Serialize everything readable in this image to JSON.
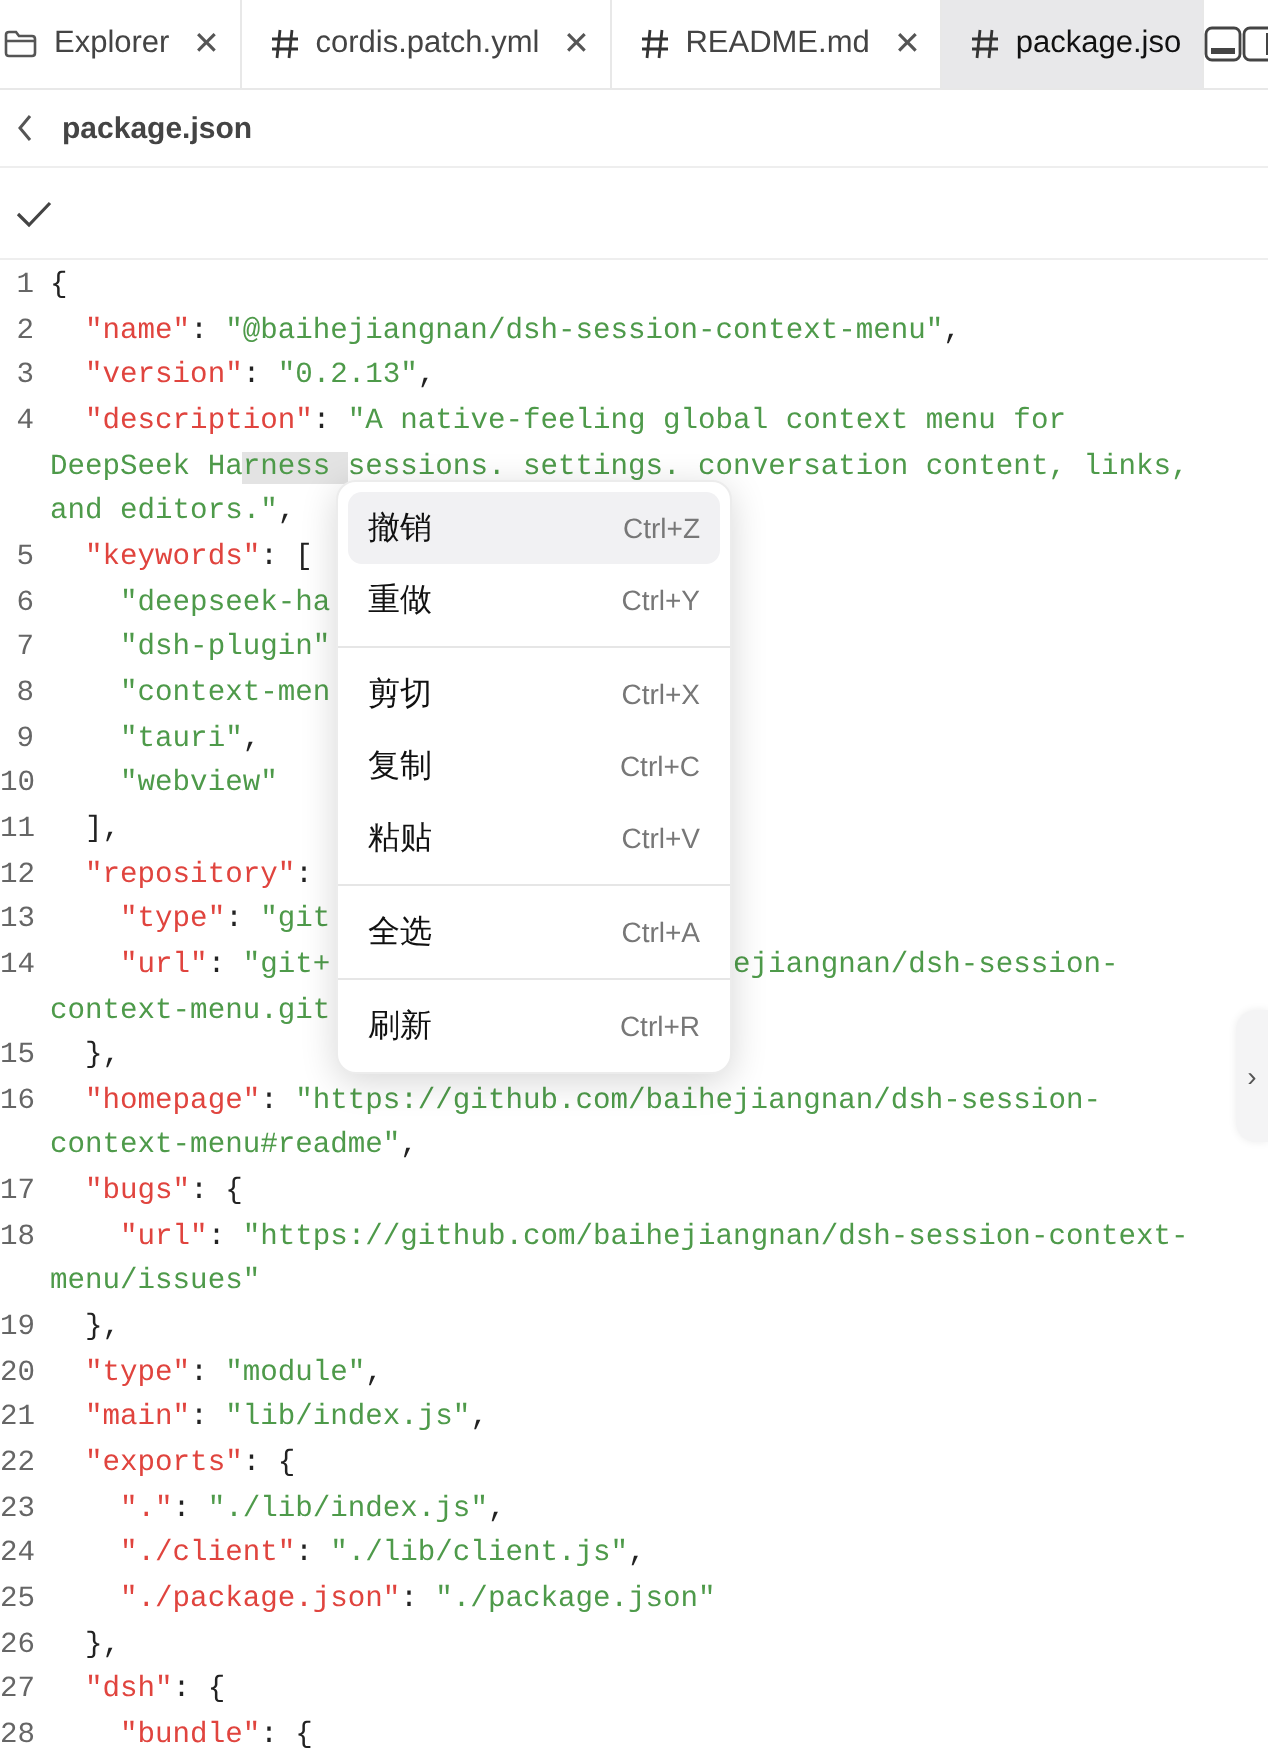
{
  "tabs": [
    {
      "kind": "folder",
      "label": "Explorer",
      "close": "✕",
      "selected": false
    },
    {
      "kind": "hash",
      "label": "cordis.patch.yml",
      "close": "✕",
      "selected": false
    },
    {
      "kind": "hash",
      "label": "README.md",
      "close": "✕",
      "selected": false
    },
    {
      "kind": "hash",
      "label": "package.jso",
      "selected": true
    }
  ],
  "header": {
    "title": "package.json"
  },
  "code_lines": [
    {
      "num": "1",
      "segments": [
        {
          "kind": "punct",
          "text": "{"
        }
      ]
    },
    {
      "num": "2",
      "segments": [
        {
          "kind": "key",
          "text": "  \"name\""
        },
        {
          "kind": "punct",
          "text": ": "
        },
        {
          "kind": "string",
          "text": "\"@baihejiangnan/dsh-session-context-menu\""
        },
        {
          "kind": "punct",
          "text": ","
        }
      ]
    },
    {
      "num": "3",
      "segments": [
        {
          "kind": "key",
          "text": "  \"version\""
        },
        {
          "kind": "punct",
          "text": ": "
        },
        {
          "kind": "string",
          "text": "\"0.2.13\""
        },
        {
          "kind": "punct",
          "text": ","
        }
      ]
    },
    {
      "num": "4",
      "segments": [
        {
          "kind": "key",
          "text": "  \"description\""
        },
        {
          "kind": "punct",
          "text": ": "
        },
        {
          "kind": "string",
          "text": "\"A native-feeling global context menu for"
        }
      ]
    },
    {
      "segments": [
        {
          "kind": "string",
          "text": "DeepSeek Ha"
        },
        {
          "kind": "selection",
          "text": "rness "
        },
        {
          "kind": "string",
          "text": "sessions. settings. conversation content, links,"
        }
      ]
    },
    {
      "segments": [
        {
          "kind": "string",
          "text": "and editors.\""
        },
        {
          "kind": "punct",
          "text": ","
        }
      ]
    },
    {
      "num": "5",
      "segments": [
        {
          "kind": "key",
          "text": "  \"keywords\""
        },
        {
          "kind": "punct",
          "text": ": ["
        }
      ]
    },
    {
      "num": "6",
      "segments": [
        {
          "kind": "string",
          "text": "    \"deepseek-ha"
        }
      ]
    },
    {
      "num": "7",
      "segments": [
        {
          "kind": "string",
          "text": "    \"dsh-plugin\""
        }
      ]
    },
    {
      "num": "8",
      "segments": [
        {
          "kind": "string",
          "text": "    \"context-men"
        }
      ]
    },
    {
      "num": "9",
      "segments": [
        {
          "kind": "string",
          "text": "    \"tauri\""
        },
        {
          "kind": "punct",
          "text": ","
        }
      ]
    },
    {
      "num": "10",
      "segments": [
        {
          "kind": "string",
          "text": "    \"webview\""
        }
      ]
    },
    {
      "num": "11",
      "segments": [
        {
          "kind": "punct",
          "text": "  ],"
        }
      ]
    },
    {
      "num": "12",
      "segments": [
        {
          "kind": "key",
          "text": "  \"repository\""
        },
        {
          "kind": "punct",
          "text": ":"
        }
      ]
    },
    {
      "num": "13",
      "segments": [
        {
          "kind": "key",
          "text": "    \"type\""
        },
        {
          "kind": "punct",
          "text": ": "
        },
        {
          "kind": "string",
          "text": "\"git"
        }
      ]
    },
    {
      "num": "14",
      "segments": [
        {
          "kind": "key",
          "text": "    \"url\""
        },
        {
          "kind": "punct",
          "text": ": "
        },
        {
          "kind": "string",
          "text": "\"git+"
        }
      ],
      "after_menu": [
        {
          "kind": "string",
          "text": "ejiangnan/dsh-session-"
        }
      ]
    },
    {
      "segments": [
        {
          "kind": "string",
          "text": "context-menu.git"
        }
      ]
    },
    {
      "num": "15",
      "segments": [
        {
          "kind": "punct",
          "text": "  },"
        }
      ]
    },
    {
      "num": "16",
      "segments": [
        {
          "kind": "key",
          "text": "  \"homepage\""
        },
        {
          "kind": "punct",
          "text": ": "
        },
        {
          "kind": "string",
          "text": "\"https://github.com/baihejiangnan/dsh-session-"
        }
      ]
    },
    {
      "segments": [
        {
          "kind": "string",
          "text": "context-menu#readme\""
        },
        {
          "kind": "punct",
          "text": ","
        }
      ]
    },
    {
      "num": "17",
      "segments": [
        {
          "kind": "key",
          "text": "  \"bugs\""
        },
        {
          "kind": "punct",
          "text": ": {"
        }
      ]
    },
    {
      "num": "18",
      "segments": [
        {
          "kind": "key",
          "text": "    \"url\""
        },
        {
          "kind": "punct",
          "text": ": "
        },
        {
          "kind": "string",
          "text": "\"https://github.com/baihejiangnan/dsh-session-context-"
        }
      ]
    },
    {
      "segments": [
        {
          "kind": "string",
          "text": "menu/issues\""
        }
      ]
    },
    {
      "num": "19",
      "segments": [
        {
          "kind": "punct",
          "text": "  },"
        }
      ]
    },
    {
      "num": "20",
      "segments": [
        {
          "kind": "key",
          "text": "  \"type\""
        },
        {
          "kind": "punct",
          "text": ": "
        },
        {
          "kind": "string",
          "text": "\"module\""
        },
        {
          "kind": "punct",
          "text": ","
        }
      ]
    },
    {
      "num": "21",
      "segments": [
        {
          "kind": "key",
          "text": "  \"main\""
        },
        {
          "kind": "punct",
          "text": ": "
        },
        {
          "kind": "string",
          "text": "\"lib/index.js\""
        },
        {
          "kind": "punct",
          "text": ","
        }
      ]
    },
    {
      "num": "22",
      "segments": [
        {
          "kind": "key",
          "text": "  \"exports\""
        },
        {
          "kind": "punct",
          "text": ": {"
        }
      ]
    },
    {
      "num": "23",
      "segments": [
        {
          "kind": "key",
          "text": "    \".\""
        },
        {
          "kind": "punct",
          "text": ": "
        },
        {
          "kind": "string",
          "text": "\"./lib/index.js\""
        },
        {
          "kind": "punct",
          "text": ","
        }
      ]
    },
    {
      "num": "24",
      "segments": [
        {
          "kind": "key",
          "text": "    \"./client\""
        },
        {
          "kind": "punct",
          "text": ": "
        },
        {
          "kind": "string",
          "text": "\"./lib/client.js\""
        },
        {
          "kind": "punct",
          "text": ","
        }
      ]
    },
    {
      "num": "25",
      "segments": [
        {
          "kind": "key",
          "text": "    \"./package.json\""
        },
        {
          "kind": "punct",
          "text": ": "
        },
        {
          "kind": "string",
          "text": "\"./package.json\""
        }
      ]
    },
    {
      "num": "26",
      "segments": [
        {
          "kind": "punct",
          "text": "  },"
        }
      ]
    },
    {
      "num": "27",
      "segments": [
        {
          "kind": "key",
          "text": "  \"dsh\""
        },
        {
          "kind": "punct",
          "text": ": {"
        }
      ]
    },
    {
      "num": "28",
      "segments": [
        {
          "kind": "key",
          "text": "    \"bundle\""
        },
        {
          "kind": "punct",
          "text": ": {"
        }
      ]
    }
  ],
  "context_menu": {
    "groups": [
      [
        {
          "label": "撤销",
          "shortcut": "Ctrl+Z",
          "selected": true
        },
        {
          "label": "重做",
          "shortcut": "Ctrl+Y",
          "selected": false
        }
      ],
      [
        {
          "label": "剪切",
          "shortcut": "Ctrl+X",
          "selected": false
        },
        {
          "label": "复制",
          "shortcut": "Ctrl+C",
          "selected": false
        },
        {
          "label": "粘贴",
          "shortcut": "Ctrl+V",
          "selected": false
        }
      ],
      [
        {
          "label": "全选",
          "shortcut": "Ctrl+A",
          "selected": false
        }
      ],
      [
        {
          "label": "刷新",
          "shortcut": "Ctrl+R",
          "selected": false
        }
      ]
    ]
  },
  "side_handle": {
    "glyph": "›"
  }
}
